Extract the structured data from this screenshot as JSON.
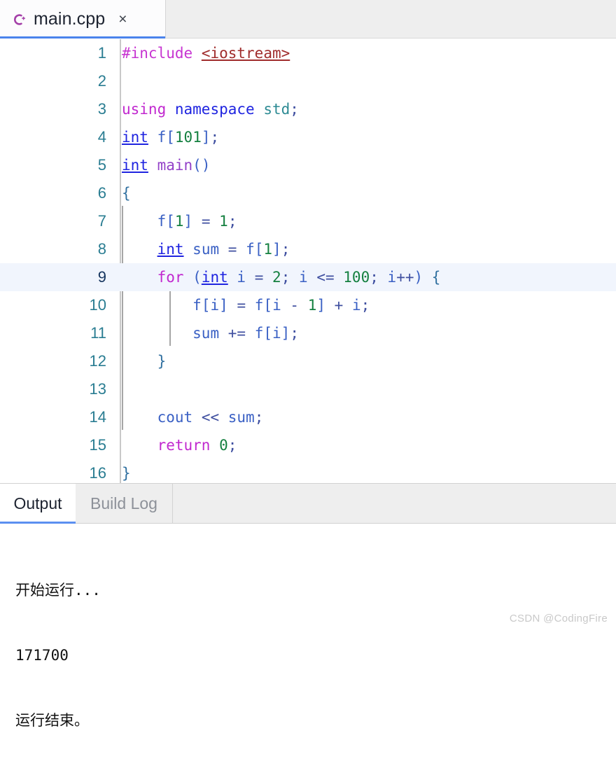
{
  "tabbar": {
    "file_tab": {
      "icon": "cpp-file-icon",
      "title": "main.cpp",
      "close_label": "×"
    }
  },
  "editor": {
    "current_line": 9,
    "lines": [
      {
        "n": "1",
        "text": "#include <iostream>"
      },
      {
        "n": "2",
        "text": ""
      },
      {
        "n": "3",
        "text": "using namespace std;"
      },
      {
        "n": "4",
        "text": "int f[101];"
      },
      {
        "n": "5",
        "text": "int main()"
      },
      {
        "n": "6",
        "text": "{"
      },
      {
        "n": "7",
        "text": "    f[1] = 1;"
      },
      {
        "n": "8",
        "text": "    int sum = f[1];"
      },
      {
        "n": "9",
        "text": "    for (int i = 2; i <= 100; i++) {"
      },
      {
        "n": "10",
        "text": "        f[i] = f[i - 1] + i;"
      },
      {
        "n": "11",
        "text": "        sum += f[i];"
      },
      {
        "n": "12",
        "text": "    }"
      },
      {
        "n": "13",
        "text": ""
      },
      {
        "n": "14",
        "text": "    cout << sum;"
      },
      {
        "n": "15",
        "text": "    return 0;"
      },
      {
        "n": "16",
        "text": "}"
      }
    ],
    "tokens": {
      "l1": {
        "pre": "#include",
        "space": " ",
        "header": "<iostream>"
      },
      "l3": {
        "kw": "using",
        "ns": "namespace",
        "std": "std",
        "semi": ";"
      },
      "l4": {
        "type": "int",
        "id": "f",
        "lb": "[",
        "num": "101",
        "rb": "]",
        "semi": ";"
      },
      "l5": {
        "type": "int",
        "fn": "main",
        "parens": "()"
      },
      "l6": {
        "brace": "{"
      },
      "l7": {
        "id": "f",
        "lb": "[",
        "num": "1",
        "rb": "]",
        "op": "=",
        "num2": "1",
        "semi": ";"
      },
      "l8": {
        "type": "int",
        "id": "sum",
        "op": "=",
        "id2": "f",
        "lb": "[",
        "num": "1",
        "rb": "]",
        "semi": ";"
      },
      "l9": {
        "kw": "for",
        "lp": "(",
        "type": "int",
        "id": "i",
        "op": "=",
        "num": "2",
        "semi": ";",
        "id2": "i",
        "cmp": "<=",
        "num2": "100",
        "semi2": ";",
        "id3": "i",
        "inc": "++",
        "rp": ")",
        "brace": "{"
      },
      "l10": {
        "id": "f",
        "lb": "[",
        "id2": "i",
        "rb": "]",
        "op": "=",
        "id3": "f",
        "lb2": "[",
        "id4": "i",
        "minus": "-",
        "num": "1",
        "rb2": "]",
        "plus": "+",
        "id5": "i",
        "semi": ";"
      },
      "l11": {
        "id": "sum",
        "op": "+=",
        "id2": "f",
        "lb": "[",
        "id3": "i",
        "rb": "]",
        "semi": ";"
      },
      "l12": {
        "brace": "}"
      },
      "l14": {
        "id": "cout",
        "op": "<<",
        "id2": "sum",
        "semi": ";"
      },
      "l15": {
        "kw": "return",
        "num": "0",
        "semi": ";"
      },
      "l16": {
        "brace": "}"
      }
    }
  },
  "panel": {
    "tabs": [
      {
        "label": "Output",
        "active": true
      },
      {
        "label": "Build Log",
        "active": false
      }
    ],
    "output_lines": [
      "开始运行...",
      "171700",
      "运行结束。"
    ]
  },
  "watermark": "CSDN @CodingFire",
  "colors": {
    "accent_blue": "#4a83ec",
    "active_line_bg": "#f1f5fd",
    "lineno": "#2a7d92",
    "preprocessor": "#c735d1",
    "header": "#a02c2c",
    "keyword": "#c128cf",
    "type": "#1f24e0",
    "std_namespace": "#2e8b94",
    "function": "#9341c8",
    "number": "#158040",
    "identifier": "#3a60c4",
    "operator": "#3f4fa0",
    "tabbar_bg": "#eeeeee"
  }
}
